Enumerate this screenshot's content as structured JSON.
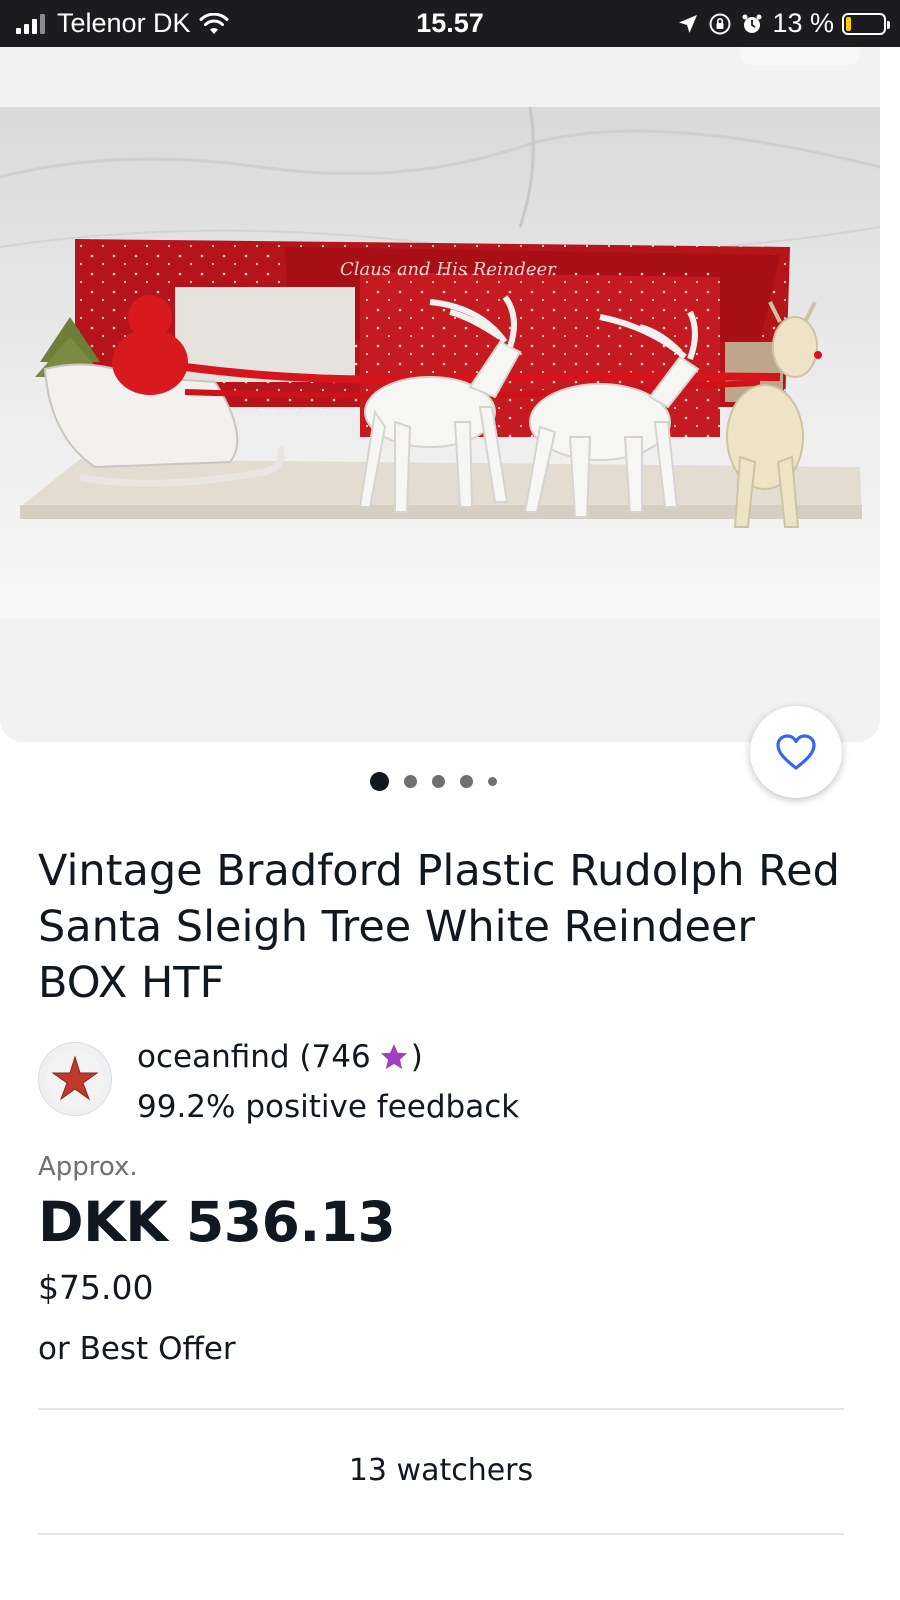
{
  "status_bar": {
    "carrier": "Telenor DK",
    "time": "15.57",
    "battery_percent": "13 %",
    "battery_level": 0.13,
    "icons": [
      "signal-icon",
      "wifi-icon",
      "location-arrow-icon",
      "rotation-lock-icon",
      "alarm-icon",
      "battery-icon"
    ]
  },
  "gallery": {
    "photo_count": 5,
    "active_index": 0,
    "watch_icon": "heart-icon"
  },
  "listing": {
    "title": "Vintage Bradford Plastic Rudolph Red Santa Sleigh Tree White Reindeer BOX HTF",
    "seller": {
      "name": "oceanfind (746",
      "close_paren": ")",
      "star_color": "#a040c0",
      "feedback": "99.2% positive feedback"
    },
    "price": {
      "approx_label": "Approx.",
      "converted": "DKK 536.13",
      "original": "$75.00",
      "best_offer": "or Best Offer"
    },
    "watchers": "13 watchers"
  }
}
